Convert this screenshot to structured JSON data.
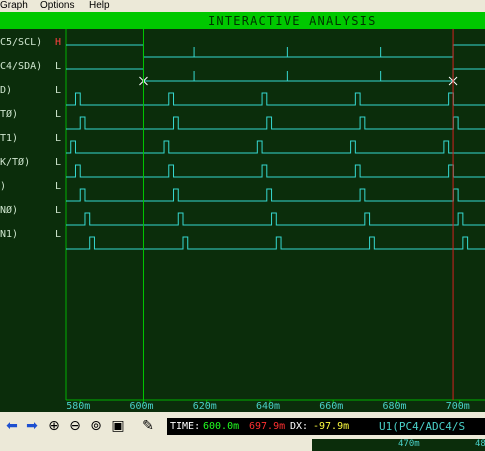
{
  "menu": {
    "items": [
      "Graph",
      "Options",
      "Help"
    ]
  },
  "title": "INTERACTIVE ANALYSIS",
  "colors": {
    "trace": "#36d8d0",
    "grid": "#00b000",
    "cursor_primary": "#00c800",
    "cursor_secondary": "#d02020",
    "marker": "#ffffff",
    "level_high": "#ff4040"
  },
  "signals": [
    {
      "label": "C5/SCL)",
      "level": "H"
    },
    {
      "label": "C4/SDA)",
      "level": "L"
    },
    {
      "label": "D)",
      "level": "L"
    },
    {
      "label": "TØ)",
      "level": "L"
    },
    {
      "label": "T1)",
      "level": "L"
    },
    {
      "label": "K/TØ)",
      "level": "L"
    },
    {
      "label": ")",
      "level": "L"
    },
    {
      "label": "NØ)",
      "level": "L"
    },
    {
      "label": "N1)",
      "level": "L"
    }
  ],
  "axis": {
    "ticks": [
      "580m",
      "600m",
      "620m",
      "640m",
      "660m",
      "680m",
      "700m"
    ],
    "t_start": 575.5,
    "t_end": 708
  },
  "cursors": {
    "primary_time": 600.0,
    "secondary_time": 697.9
  },
  "pulses": {
    "start_ms": [
      600.0
    ],
    "period_ms": 29.5,
    "offsets_ms": [
      3.0,
      4.5,
      1.5,
      3.0,
      4.5,
      6.0,
      7.5
    ],
    "width_ms": 1.2
  },
  "toolbar": {
    "icons": [
      "arrow-left-icon",
      "arrow-right-icon",
      "zoom-in-icon",
      "zoom-out-icon",
      "zoom-fit-icon",
      "zoom-area-icon",
      "marker-icon"
    ]
  },
  "status": {
    "time_label": "TIME:",
    "time_value": "600.0m",
    "cursor2_value": "697.9m",
    "dx_label": "DX:",
    "dx_value": "-97.9m",
    "probe": "U1(PC4/ADC4/S"
  },
  "ruler": {
    "label": "470m",
    "label2": "48"
  }
}
